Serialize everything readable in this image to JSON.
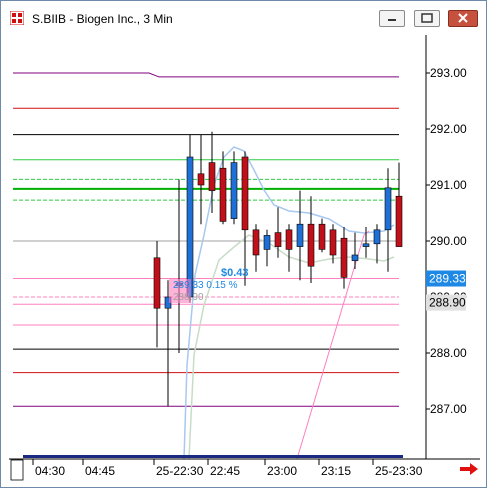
{
  "window": {
    "title": "S.BIIB - Biogen Inc., 3 Min",
    "minimize_label": "minimize",
    "restore_label": "restore",
    "close_label": "close"
  },
  "chart_data": {
    "type": "candlestick",
    "title": "S.BIIB - Biogen Inc., 3 Min",
    "ylim": [
      286.5,
      293.5
    ],
    "y_ticks": [
      "293.00",
      "292.00",
      "291.00",
      "290.00",
      "289.00",
      "288.00",
      "287.00"
    ],
    "x_labels": [
      "04:30",
      "04:45",
      "25-22:30",
      "22:45",
      "23:00",
      "23:15",
      "25-23:30"
    ],
    "price_labels": [
      {
        "text": "289.33",
        "value": 289.33,
        "color": "#1e88e5",
        "text_color": "#ffffff"
      },
      {
        "text": "288.90",
        "value": 288.9,
        "color": "#e0e0e0",
        "text_color": "#000000"
      }
    ],
    "annotations": {
      "change_amount": "$0.43",
      "change_percent": "289.33 0.15 %",
      "faded_value": "288.90"
    },
    "candles": [
      {
        "open": 289.7,
        "high": 290.0,
        "low": 288.1,
        "close": 288.8
      },
      {
        "open": 288.8,
        "high": 289.3,
        "low": 287.05,
        "close": 289.0
      },
      {
        "open": 289.2,
        "high": 291.1,
        "low": 288.0,
        "close": 289.25
      },
      {
        "open": 289.0,
        "high": 291.9,
        "low": 288.9,
        "close": 291.5
      },
      {
        "open": 291.2,
        "high": 291.9,
        "low": 290.3,
        "close": 291.0
      },
      {
        "open": 291.4,
        "high": 291.95,
        "low": 290.5,
        "close": 290.9
      },
      {
        "open": 291.3,
        "high": 291.6,
        "low": 290.3,
        "close": 290.35
      },
      {
        "open": 290.4,
        "high": 291.6,
        "low": 290.3,
        "close": 291.4
      },
      {
        "open": 291.5,
        "high": 291.6,
        "low": 289.2,
        "close": 290.2
      },
      {
        "open": 290.2,
        "high": 290.3,
        "low": 289.45,
        "close": 289.75
      },
      {
        "open": 289.85,
        "high": 290.2,
        "low": 289.55,
        "close": 290.1
      },
      {
        "open": 290.15,
        "high": 290.6,
        "low": 289.7,
        "close": 289.9
      },
      {
        "open": 290.2,
        "high": 290.3,
        "low": 289.45,
        "close": 289.85
      },
      {
        "open": 289.9,
        "high": 290.9,
        "low": 289.3,
        "close": 290.3
      },
      {
        "open": 290.3,
        "high": 290.8,
        "low": 289.25,
        "close": 289.55
      },
      {
        "open": 290.3,
        "high": 290.4,
        "low": 289.8,
        "close": 289.85
      },
      {
        "open": 290.2,
        "high": 290.3,
        "low": 289.6,
        "close": 289.75
      },
      {
        "open": 290.05,
        "high": 290.25,
        "low": 289.15,
        "close": 289.35
      },
      {
        "open": 289.65,
        "high": 290.15,
        "low": 289.5,
        "close": 289.75
      },
      {
        "open": 289.9,
        "high": 290.25,
        "low": 289.7,
        "close": 289.95
      },
      {
        "open": 289.95,
        "high": 290.3,
        "low": 289.6,
        "close": 290.2
      },
      {
        "open": 290.2,
        "high": 291.3,
        "low": 289.45,
        "close": 290.95
      },
      {
        "open": 290.8,
        "high": 291.4,
        "low": 289.9,
        "close": 289.9
      }
    ],
    "levels": [
      {
        "value": 292.93,
        "color": "#800080",
        "prior": 293.0
      },
      {
        "value": 292.37,
        "color": "#d01010",
        "prior": 292.37
      },
      {
        "value": 291.9,
        "color": "#000000",
        "prior": 291.9
      },
      {
        "value": 291.45,
        "color": "#2ecc40",
        "prior": 291.45
      },
      {
        "value": 291.1,
        "color": "#2ecc40",
        "prior": 291.1,
        "dashed": true
      },
      {
        "value": 290.93,
        "color": "#00b000",
        "prior": 290.93,
        "bold": true
      },
      {
        "value": 290.73,
        "color": "#2ecc40",
        "prior": 290.73,
        "dashed": true
      },
      {
        "value": 290.0,
        "color": "#a0a0a0",
        "prior": 290.0
      },
      {
        "value": 289.0,
        "color": "#ff80c0",
        "prior": 289.0,
        "dashed": true
      },
      {
        "value": 289.33,
        "color": "#ff80c0",
        "prior": 289.33
      },
      {
        "value": 288.87,
        "color": "#ff80c0",
        "prior": 288.87
      },
      {
        "value": 288.5,
        "color": "#ff80c0",
        "prior": 288.5
      },
      {
        "value": 288.07,
        "color": "#000000",
        "prior": 288.07
      },
      {
        "value": 287.65,
        "color": "#d01010",
        "prior": 287.65
      },
      {
        "value": 287.05,
        "color": "#800080",
        "prior": 287.05
      }
    ]
  }
}
